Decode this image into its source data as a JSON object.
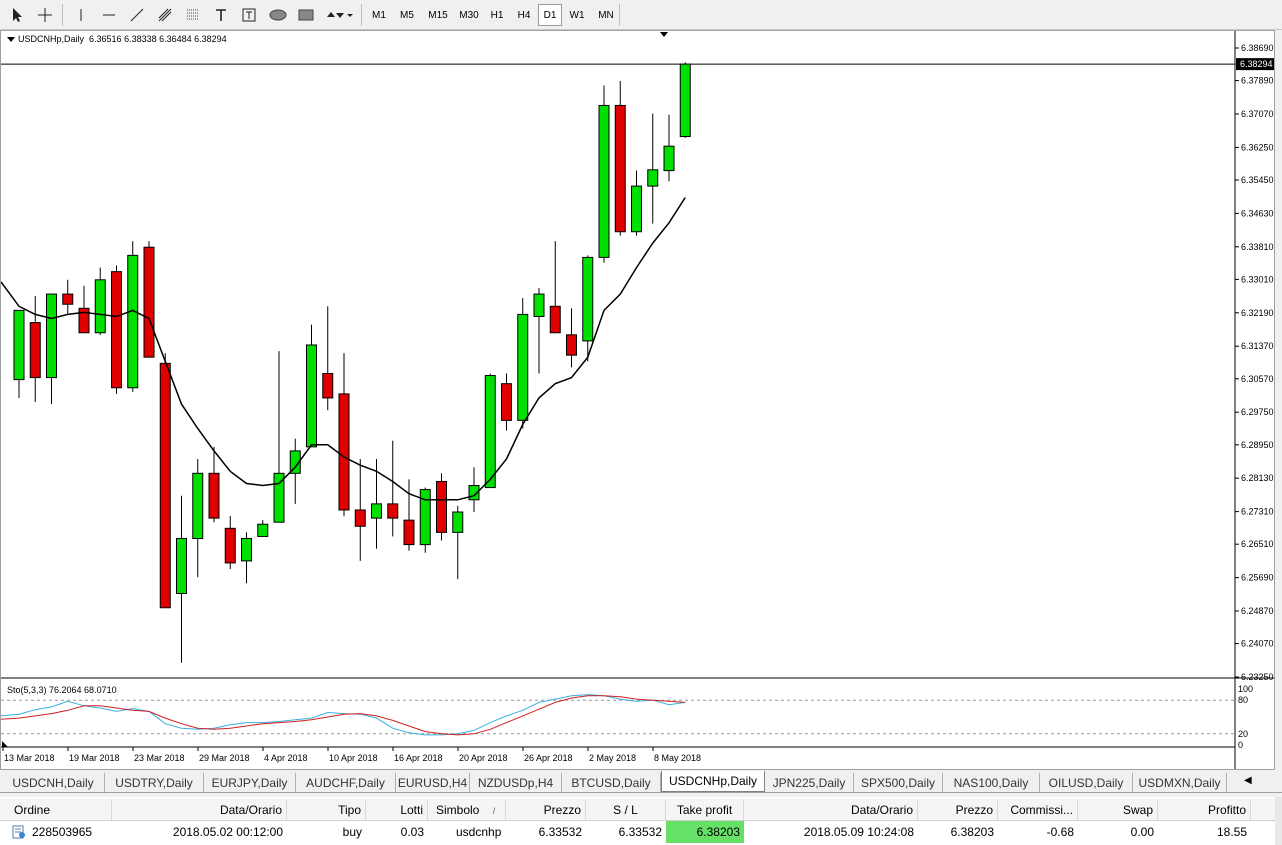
{
  "toolbar": {
    "timeframes": [
      "M1",
      "M5",
      "M15",
      "M30",
      "H1",
      "H4",
      "D1",
      "W1",
      "MN"
    ],
    "active_timeframe": "D1",
    "tools": [
      "cursor-icon",
      "crosshair-icon",
      "vertical-line-icon",
      "horizontal-line-icon",
      "trendline-icon",
      "equidistant-channel-icon",
      "fibonacci-icon",
      "text-icon",
      "text-label-icon",
      "ellipse-icon",
      "rectangle-icon",
      "arrows-icon"
    ]
  },
  "chart": {
    "header_symbol": "USDCNHp,Daily",
    "header_ohlc": "6.36516 6.38338 6.36484 6.38294",
    "current_price_label": "6.38294",
    "stoch_label": "Sto(5,3,3) 76.2064 68.0710",
    "colors": {
      "bull": "#00e000",
      "bear": "#e00000",
      "ma": "#000000",
      "stoch_main": "#3ab0e0",
      "stoch_signal": "#d02020"
    },
    "price_ticks": [
      "6.38690",
      "6.37890",
      "6.37070",
      "6.36250",
      "6.35450",
      "6.34630",
      "6.33810",
      "6.33010",
      "6.32190",
      "6.31370",
      "6.30570",
      "6.29750",
      "6.28950",
      "6.28130",
      "6.27310",
      "6.26510",
      "6.25690",
      "6.24870",
      "6.24070",
      "6.23250"
    ],
    "stoch_ticks": [
      "100",
      "80",
      "20",
      "0"
    ],
    "date_ticks": [
      "13 Mar 2018",
      "19 Mar 2018",
      "23 Mar 2018",
      "29 Mar 2018",
      "4 Apr 2018",
      "10 Apr 2018",
      "16 Apr 2018",
      "20 Apr 2018",
      "26 Apr 2018",
      "2 May 2018",
      "8 May 2018"
    ]
  },
  "chart_data": {
    "type": "candlestick",
    "symbol": "USDCNHp",
    "timeframe": "Daily",
    "ylim": [
      6.2325,
      6.3869
    ],
    "candles": [
      {
        "o": 6.3055,
        "h": 6.3195,
        "l": 6.301,
        "c": 6.3225
      },
      {
        "o": 6.3195,
        "h": 6.326,
        "l": 6.3,
        "c": 6.306
      },
      {
        "o": 6.306,
        "h": 6.326,
        "l": 6.2995,
        "c": 6.3265
      },
      {
        "o": 6.3265,
        "h": 6.33,
        "l": 6.3215,
        "c": 6.324
      },
      {
        "o": 6.323,
        "h": 6.3285,
        "l": 6.3175,
        "c": 6.317
      },
      {
        "o": 6.317,
        "h": 6.333,
        "l": 6.3165,
        "c": 6.33
      },
      {
        "o": 6.332,
        "h": 6.3335,
        "l": 6.302,
        "c": 6.3035
      },
      {
        "o": 6.3035,
        "h": 6.3395,
        "l": 6.3025,
        "c": 6.336
      },
      {
        "o": 6.338,
        "h": 6.3395,
        "l": 6.311,
        "c": 6.311
      },
      {
        "o": 6.3095,
        "h": 6.312,
        "l": 6.2495,
        "c": 6.2495
      },
      {
        "o": 6.253,
        "h": 6.277,
        "l": 6.236,
        "c": 6.2665
      },
      {
        "o": 6.2665,
        "h": 6.286,
        "l": 6.257,
        "c": 6.2825
      },
      {
        "o": 6.2825,
        "h": 6.289,
        "l": 6.2705,
        "c": 6.2715
      },
      {
        "o": 6.269,
        "h": 6.272,
        "l": 6.259,
        "c": 6.2605
      },
      {
        "o": 6.261,
        "h": 6.268,
        "l": 6.2555,
        "c": 6.2665
      },
      {
        "o": 6.267,
        "h": 6.271,
        "l": 6.267,
        "c": 6.27
      },
      {
        "o": 6.2705,
        "h": 6.3125,
        "l": 6.2705,
        "c": 6.2825
      },
      {
        "o": 6.2825,
        "h": 6.291,
        "l": 6.275,
        "c": 6.288
      },
      {
        "o": 6.289,
        "h": 6.319,
        "l": 6.289,
        "c": 6.314
      },
      {
        "o": 6.307,
        "h": 6.3235,
        "l": 6.298,
        "c": 6.301
      },
      {
        "o": 6.302,
        "h": 6.312,
        "l": 6.272,
        "c": 6.2735
      },
      {
        "o": 6.2735,
        "h": 6.286,
        "l": 6.261,
        "c": 6.2695
      },
      {
        "o": 6.2715,
        "h": 6.286,
        "l": 6.264,
        "c": 6.275
      },
      {
        "o": 6.275,
        "h": 6.2905,
        "l": 6.267,
        "c": 6.2715
      },
      {
        "o": 6.271,
        "h": 6.281,
        "l": 6.2635,
        "c": 6.265
      },
      {
        "o": 6.265,
        "h": 6.279,
        "l": 6.263,
        "c": 6.2785
      },
      {
        "o": 6.2805,
        "h": 6.2825,
        "l": 6.266,
        "c": 6.268
      },
      {
        "o": 6.268,
        "h": 6.2745,
        "l": 6.2565,
        "c": 6.273
      },
      {
        "o": 6.276,
        "h": 6.284,
        "l": 6.273,
        "c": 6.2795
      },
      {
        "o": 6.279,
        "h": 6.307,
        "l": 6.279,
        "c": 6.3065
      },
      {
        "o": 6.3045,
        "h": 6.307,
        "l": 6.293,
        "c": 6.2955
      },
      {
        "o": 6.2955,
        "h": 6.3255,
        "l": 6.2935,
        "c": 6.3215
      },
      {
        "o": 6.321,
        "h": 6.328,
        "l": 6.307,
        "c": 6.3265
      },
      {
        "o": 6.3235,
        "h": 6.3395,
        "l": 6.317,
        "c": 6.317
      },
      {
        "o": 6.3165,
        "h": 6.323,
        "l": 6.3085,
        "c": 6.3115
      },
      {
        "o": 6.315,
        "h": 6.336,
        "l": 6.31,
        "c": 6.3355
      },
      {
        "o": 6.3355,
        "h": 6.3777,
        "l": 6.3342,
        "c": 6.3728
      },
      {
        "o": 6.3728,
        "h": 6.3788,
        "l": 6.3408,
        "c": 6.3418
      },
      {
        "o": 6.3418,
        "h": 6.3568,
        "l": 6.3408,
        "c": 6.353
      },
      {
        "o": 6.353,
        "h": 6.3708,
        "l": 6.3438,
        "c": 6.357
      },
      {
        "o": 6.3568,
        "h": 6.3705,
        "l": 6.3542,
        "c": 6.3628
      },
      {
        "o": 6.36516,
        "h": 6.38338,
        "l": 6.36484,
        "c": 6.38294
      }
    ],
    "moving_average": [
      6.3235,
      6.3215,
      6.3205,
      6.3215,
      6.322,
      6.3215,
      6.321,
      6.3225,
      6.3205,
      6.31,
      6.2995,
      6.2935,
      6.288,
      6.283,
      6.28,
      6.2795,
      6.28,
      6.284,
      6.2895,
      6.2895,
      6.2865,
      6.2845,
      6.283,
      6.2805,
      6.2775,
      6.276,
      6.276,
      6.276,
      6.277,
      6.281,
      6.286,
      6.2945,
      6.301,
      6.3045,
      6.306,
      6.311,
      6.3225,
      6.3265,
      6.333,
      6.339,
      6.344,
      6.3502
    ],
    "stochastic_main": [
      55,
      63,
      68,
      78,
      70,
      66,
      60,
      65,
      60,
      38,
      30,
      28,
      30,
      36,
      40,
      40,
      42,
      45,
      48,
      58,
      56,
      55,
      48,
      30,
      22,
      18,
      18,
      20,
      26,
      40,
      52,
      62,
      76,
      82,
      88,
      90,
      88,
      82,
      78,
      80,
      72,
      76
    ],
    "stochastic_signal": [
      48,
      52,
      56,
      62,
      70,
      70,
      66,
      62,
      60,
      48,
      38,
      30,
      28,
      30,
      34,
      38,
      40,
      42,
      45,
      50,
      55,
      56,
      52,
      44,
      34,
      24,
      20,
      18,
      20,
      28,
      40,
      52,
      64,
      76,
      84,
      88,
      88,
      86,
      82,
      80,
      78,
      76
    ]
  },
  "tabs": {
    "items": [
      "USDCNH,Daily",
      "USDTRY,Daily",
      "EURJPY,Daily",
      "AUDCHF,Daily",
      "EURUSD,H4",
      "NZDUSDp,H4",
      "BTCUSD,Daily",
      "USDCNHp,Daily",
      "JPN225,Daily",
      "SPX500,Daily",
      "NAS100,Daily",
      "OILUSD,Daily",
      "USDMXN,Daily"
    ],
    "active": "USDCNHp,Daily"
  },
  "orders": {
    "headers": {
      "order": "Ordine",
      "time_open": "Data/Orario",
      "type": "Tipo",
      "lots": "Lotti",
      "symbol": "Simbolo",
      "symbol_sort": "/",
      "price_open": "Prezzo",
      "sl": "S / L",
      "tp": "Take profit",
      "time_close": "Data/Orario",
      "price_close": "Prezzo",
      "commission": "Commissi...",
      "swap": "Swap",
      "profit": "Profitto"
    },
    "row": {
      "order": "228503965",
      "time_open": "2018.05.02 00:12:00",
      "type": "buy",
      "lots": "0.03",
      "symbol": "usdcnhp",
      "price_open": "6.33532",
      "sl": "6.33532",
      "tp": "6.38203",
      "time_close": "2018.05.09 10:24:08",
      "price_close": "6.38203",
      "commission": "-0.68",
      "swap": "0.00",
      "profit": "18.55"
    }
  }
}
